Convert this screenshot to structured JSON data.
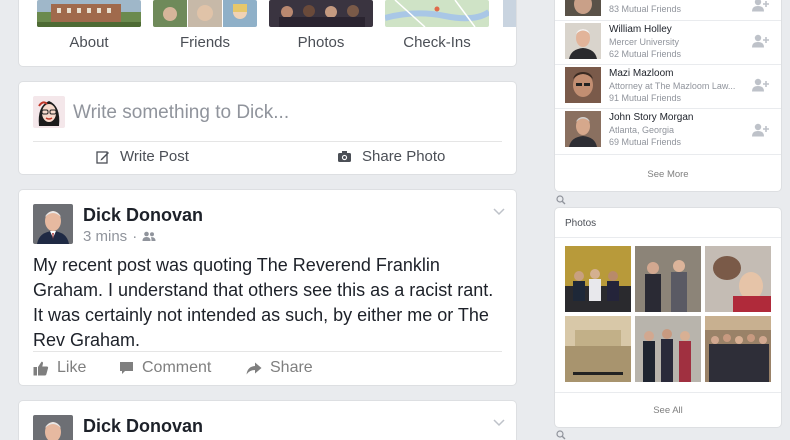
{
  "profile_nav": {
    "items": [
      {
        "label": "About"
      },
      {
        "label": "Friends"
      },
      {
        "label": "Photos"
      },
      {
        "label": "Check-Ins"
      }
    ]
  },
  "composer": {
    "placeholder": "Write something to Dick...",
    "write_post_label": "Write Post",
    "share_photo_label": "Share Photo"
  },
  "posts": [
    {
      "author": "Dick Donovan",
      "time": "3 mins",
      "separator": "·",
      "privacy_icon": "friends-icon",
      "text": "My recent post was quoting The Reverend Franklin Graham. I understand that others see this as a racist rant. It was certainly not intended as such, by either me or The Rev Graham.",
      "actions": {
        "like": "Like",
        "comment": "Comment",
        "share": "Share"
      }
    },
    {
      "author": "Dick Donovan"
    }
  ],
  "friends_panel": {
    "items": [
      {
        "name": "",
        "subtitle": "",
        "mutual": "83 Mutual Friends"
      },
      {
        "name": "William Holley",
        "subtitle": "Mercer University",
        "mutual": "62 Mutual Friends"
      },
      {
        "name": "Mazi Mazloom",
        "subtitle": "Attorney at The Mazloom Law...",
        "mutual": "91 Mutual Friends"
      },
      {
        "name": "John Story Morgan",
        "subtitle": "Atlanta, Georgia",
        "mutual": "69 Mutual Friends"
      }
    ],
    "see_more": "See More"
  },
  "photos_panel": {
    "title": "Photos",
    "see_all": "See All"
  },
  "colors": {
    "background": "#e9ebee",
    "card": "#ffffff",
    "text_primary": "#1d2129",
    "text_secondary": "#90949c",
    "action_gray": "#7f7f7f"
  }
}
